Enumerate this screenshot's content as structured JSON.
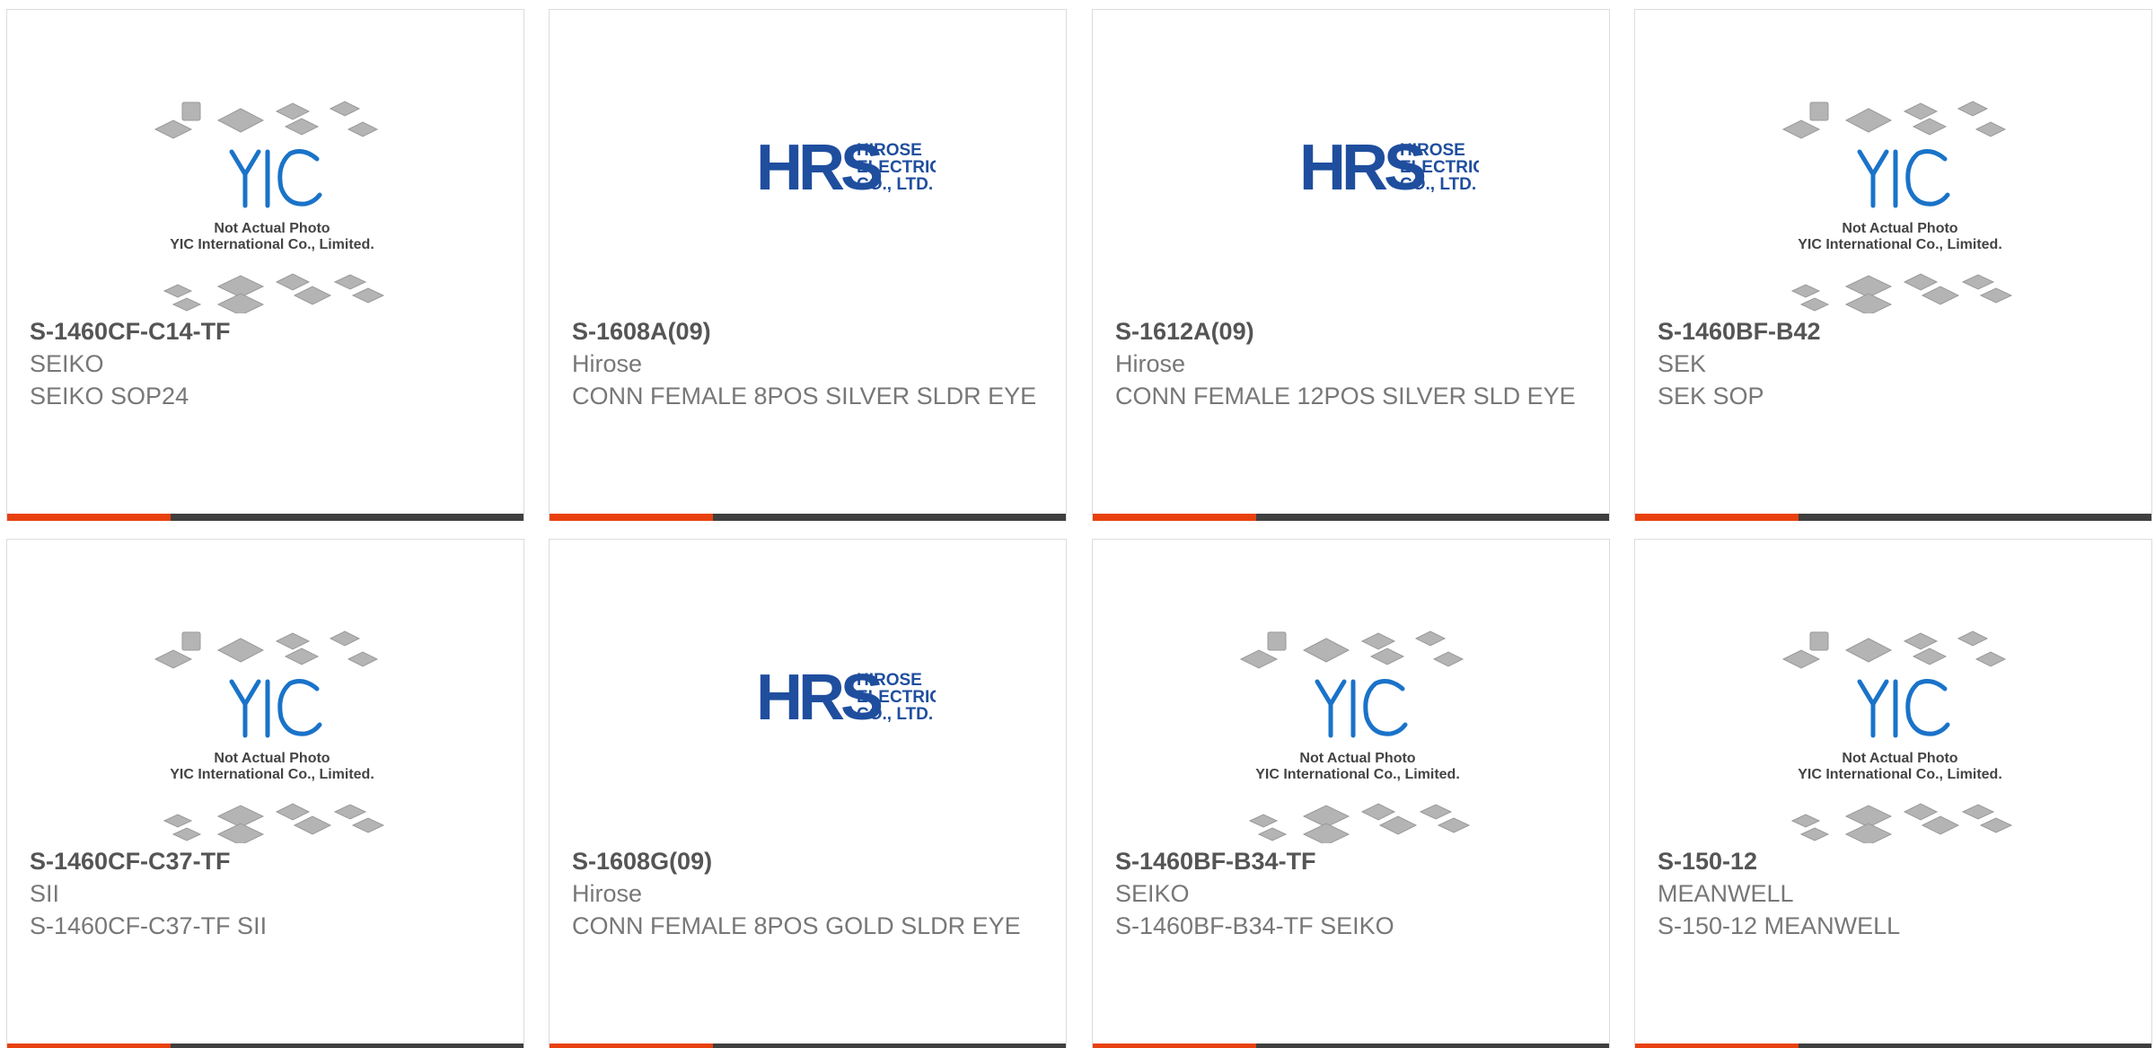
{
  "colors": {
    "accent": "#e8410f",
    "bar": "#3f3f3f",
    "hrs_blue": "#1f4e9e",
    "yic_blue": "#1a73c9"
  },
  "products": [
    {
      "part": "S-1460CF-C14-TF",
      "manufacturer": "SEIKO",
      "description": "SEIKO SOP24",
      "image": "yic"
    },
    {
      "part": "S-1608A(09)",
      "manufacturer": "Hirose",
      "description": "CONN FEMALE 8POS SILVER SLDR EYE",
      "image": "hrs"
    },
    {
      "part": "S-1612A(09)",
      "manufacturer": "Hirose",
      "description": "CONN FEMALE 12POS SILVER SLD EYE",
      "image": "hrs"
    },
    {
      "part": "S-1460BF-B42",
      "manufacturer": "SEK",
      "description": "SEK SOP",
      "image": "yic"
    },
    {
      "part": "S-1460CF-C37-TF",
      "manufacturer": "SII",
      "description": "S-1460CF-C37-TF SII",
      "image": "yic"
    },
    {
      "part": "S-1608G(09)",
      "manufacturer": "Hirose",
      "description": "CONN FEMALE 8POS GOLD SLDR EYE",
      "image": "hrs"
    },
    {
      "part": "S-1460BF-B34-TF",
      "manufacturer": "SEIKO",
      "description": "S-1460BF-B34-TF SEIKO",
      "image": "yic"
    },
    {
      "part": "S-150-12",
      "manufacturer": "MEANWELL",
      "description": "S-150-12 MEANWELL",
      "image": "yic"
    }
  ],
  "placeholder_yic": {
    "line1": "Not Actual Photo",
    "line2": "YIC International Co., Limited.",
    "logo": "YIC"
  },
  "placeholder_hrs": {
    "logo": "HRS",
    "line1": "HIROSE",
    "line2": "ELECTRIC",
    "line3": "CO., LTD."
  }
}
